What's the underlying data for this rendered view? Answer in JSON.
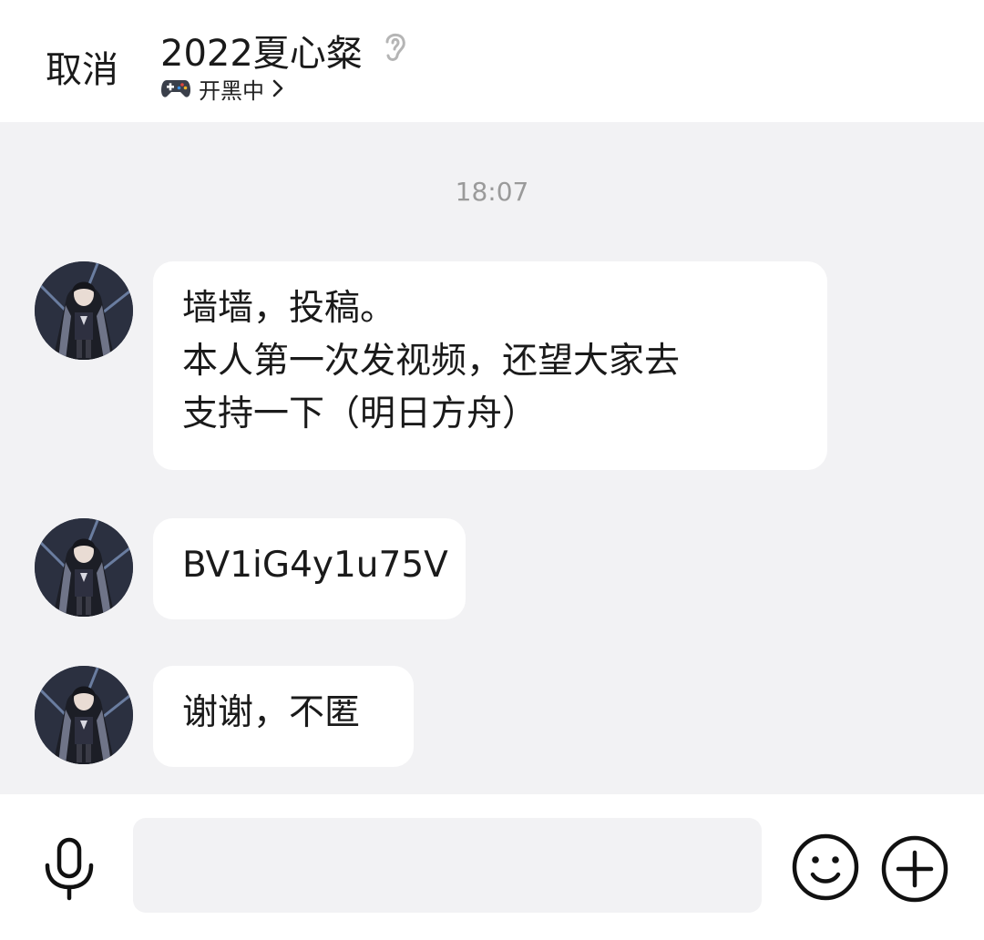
{
  "header": {
    "cancel_label": "取消",
    "title": "2022夏心粲",
    "title_icon": "ear-icon",
    "status_icon": "gamepad-icon",
    "status_text": "开黑中",
    "status_chevron_icon": "chevron-right-icon"
  },
  "chat": {
    "timestamp": "18:07",
    "messages": [
      {
        "avatar_icon": "anime-character-avatar",
        "lines": [
          "墙墙，投稿。",
          "本人第一次发视频，还望大家去",
          "支持一下（明日方舟）"
        ]
      },
      {
        "avatar_icon": "anime-character-avatar",
        "lines": [
          "BV1iG4y1u75V"
        ]
      },
      {
        "avatar_icon": "anime-character-avatar",
        "lines": [
          "谢谢，不匿"
        ]
      }
    ]
  },
  "input_bar": {
    "voice_icon": "microphone-icon",
    "input_value": "",
    "emoji_icon": "smiley-icon",
    "more_icon": "plus-circle-icon"
  },
  "colors": {
    "background": "#f2f2f4",
    "bubble": "#ffffff",
    "text": "#1a1a1a",
    "timestamp": "#9a9a9a"
  }
}
